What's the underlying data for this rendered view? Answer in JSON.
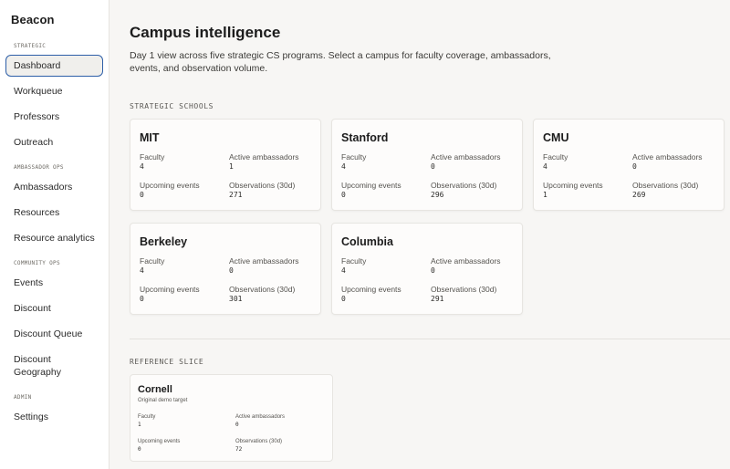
{
  "sidebar": {
    "brand": "Beacon",
    "sections": [
      {
        "label": "STRATEGIC",
        "items": [
          "Dashboard",
          "Workqueue",
          "Professors",
          "Outreach"
        ]
      },
      {
        "label": "AMBASSADOR OPS",
        "items": [
          "Ambassadors",
          "Resources",
          "Resource analytics"
        ]
      },
      {
        "label": "COMMUNITY OPS",
        "items": [
          "Events",
          "Discount",
          "Discount Queue",
          "Discount Geography"
        ]
      },
      {
        "label": "ADMIN",
        "items": [
          "Settings"
        ]
      }
    ],
    "active": "Dashboard"
  },
  "main": {
    "title": "Campus intelligence",
    "subtitle": "Day 1 view across five strategic CS programs. Select a campus for faculty coverage, ambassadors, events, and observation volume.",
    "strategic_label": "STRATEGIC SCHOOLS",
    "metric_labels": {
      "faculty": "Faculty",
      "active_ambassadors": "Active ambassadors",
      "upcoming_events": "Upcoming events",
      "observations": "Observations (30d)"
    },
    "schools": [
      {
        "name": "MIT",
        "faculty": "4",
        "active_ambassadors": "1",
        "upcoming_events": "0",
        "observations": "271"
      },
      {
        "name": "Stanford",
        "faculty": "4",
        "active_ambassadors": "0",
        "upcoming_events": "0",
        "observations": "296"
      },
      {
        "name": "CMU",
        "faculty": "4",
        "active_ambassadors": "0",
        "upcoming_events": "1",
        "observations": "269"
      },
      {
        "name": "Berkeley",
        "faculty": "4",
        "active_ambassadors": "0",
        "upcoming_events": "0",
        "observations": "301"
      },
      {
        "name": "Columbia",
        "faculty": "4",
        "active_ambassadors": "0",
        "upcoming_events": "0",
        "observations": "291"
      }
    ],
    "reference_label": "REFERENCE SLICE",
    "reference": {
      "name": "Cornell",
      "subtitle": "Original demo target",
      "faculty": "1",
      "active_ambassadors": "0",
      "upcoming_events": "0",
      "observations": "72"
    }
  }
}
